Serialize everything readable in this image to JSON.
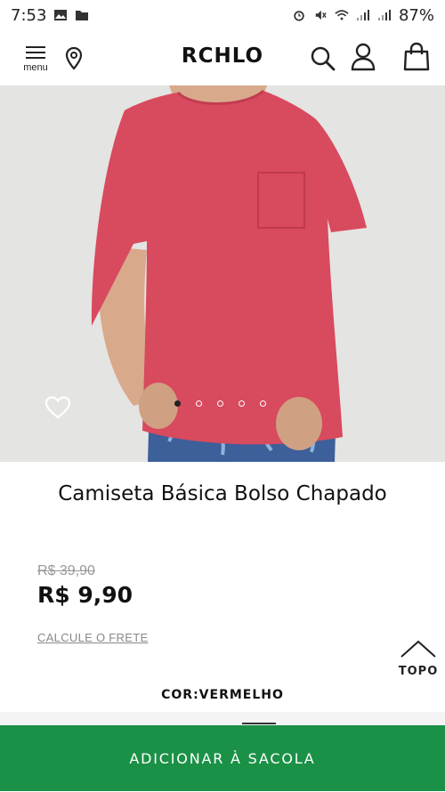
{
  "status_bar": {
    "time": "7:53",
    "battery": "87%",
    "icons_left": [
      "image-icon",
      "folder-icon"
    ],
    "icons_right": [
      "alarm-icon",
      "mute-icon",
      "wifi-icon",
      "signal-icon",
      "signal-icon"
    ]
  },
  "header": {
    "menu_label": "menu",
    "logo": "RCHLO",
    "icons": [
      "menu-icon",
      "location-pin-icon",
      "search-icon",
      "user-icon",
      "shopping-bag-icon"
    ]
  },
  "gallery": {
    "image_count": 5,
    "active_index": 0,
    "favorite_icon": "heart-icon"
  },
  "product": {
    "title": "Camiseta Básica Bolso Chapado",
    "old_price": "R$ 39,90",
    "price": "R$ 9,90",
    "shipping_link": "CALCULE O FRETE",
    "color_label": "COR:",
    "color_value": "VERMELHO"
  },
  "scroll_top": {
    "label": "TOPO"
  },
  "cta": {
    "add_to_bag": "ADICIONAR À SACOLA",
    "color": "#1a9146"
  }
}
